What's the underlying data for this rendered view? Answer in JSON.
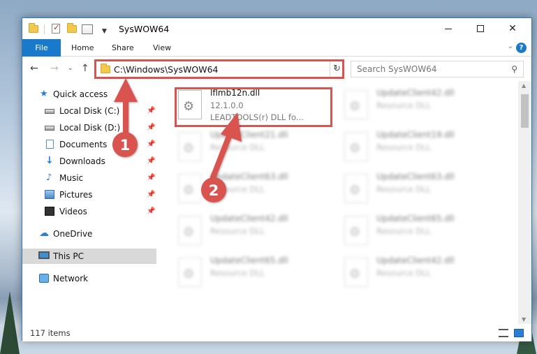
{
  "window": {
    "title": "SysWOW64",
    "minimize_label": "",
    "maximize_label": "",
    "close_label": "✕"
  },
  "ribbon": {
    "tabs": [
      "File",
      "Home",
      "Share",
      "View"
    ]
  },
  "address": {
    "path": "C:\\Windows\\SysWOW64",
    "refresh_icon": "↻"
  },
  "search": {
    "placeholder": "Search SysWOW64",
    "icon": "search-icon"
  },
  "nav": {
    "items": [
      {
        "label": "Quick access",
        "icon": "star-icon"
      },
      {
        "label": "Local Disk (C:)",
        "icon": "drive-icon",
        "pinned": true
      },
      {
        "label": "Local Disk (D:)",
        "icon": "drive-icon",
        "pinned": true
      },
      {
        "label": "Documents",
        "icon": "documents-icon",
        "pinned": true
      },
      {
        "label": "Downloads",
        "icon": "downloads-icon",
        "pinned": true
      },
      {
        "label": "Music",
        "icon": "music-icon",
        "pinned": true
      },
      {
        "label": "Pictures",
        "icon": "pictures-icon",
        "pinned": true
      },
      {
        "label": "Videos",
        "icon": "videos-icon",
        "pinned": true
      },
      {
        "label": "OneDrive",
        "icon": "cloud-icon"
      },
      {
        "label": "This PC",
        "icon": "computer-icon",
        "selected": true
      },
      {
        "label": "Network",
        "icon": "network-icon"
      }
    ]
  },
  "files": [
    {
      "name": "lflmb12n.dll",
      "line2": "12.1.0.0",
      "line3": "LEADTOOLS(r) DLL fo...",
      "highlighted": true
    },
    {
      "name": "UpdateClient42.dll",
      "line2": "Resource DLL",
      "blurred": true
    },
    {
      "name": "UpdateClient21.dll",
      "line2": "Resource DLL",
      "blurred": true
    },
    {
      "name": "UpdateClient19.dll",
      "line2": "Resource DLL",
      "blurred": true
    },
    {
      "name": "UpdateClient63.dll",
      "line2": "Resource DLL",
      "blurred": true
    },
    {
      "name": "UpdateClient63.dll",
      "line2": "Resource DLL",
      "blurred": true
    },
    {
      "name": "UpdateClient42.dll",
      "line2": "Resource DLL",
      "blurred": true
    },
    {
      "name": "UpdateClient65.dll",
      "line2": "Resource DLL",
      "blurred": true
    },
    {
      "name": "UpdateClient65.dll",
      "line2": "Resource DLL",
      "blurred": true
    },
    {
      "name": "UpdateClient42.dll",
      "line2": "Resource DLL",
      "blurred": true
    }
  ],
  "status": {
    "item_count": "117 items"
  },
  "annotations": {
    "badge_1": "1",
    "badge_2": "2",
    "color": "#d9534f"
  },
  "colors": {
    "accent": "#1979ca",
    "highlight": "#d9534f"
  }
}
